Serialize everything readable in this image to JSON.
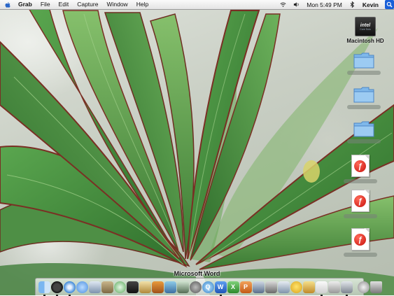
{
  "menubar": {
    "app_name": "Grab",
    "items": [
      "File",
      "Edit",
      "Capture",
      "Window",
      "Help"
    ],
    "clock": "Mon 5:49 PM",
    "user": "Kevin"
  },
  "desktop": {
    "hd_badge": "intel",
    "hd_badge_sub": "Core Solo",
    "hd_label": "Macintosh HD"
  },
  "dock": {
    "tooltip": "Microsoft Word"
  },
  "colors": {
    "leaf_green": "#3f8a3c",
    "leaf_edge": "#7a2f24",
    "spotlight_blue": "#1a5fd8"
  }
}
